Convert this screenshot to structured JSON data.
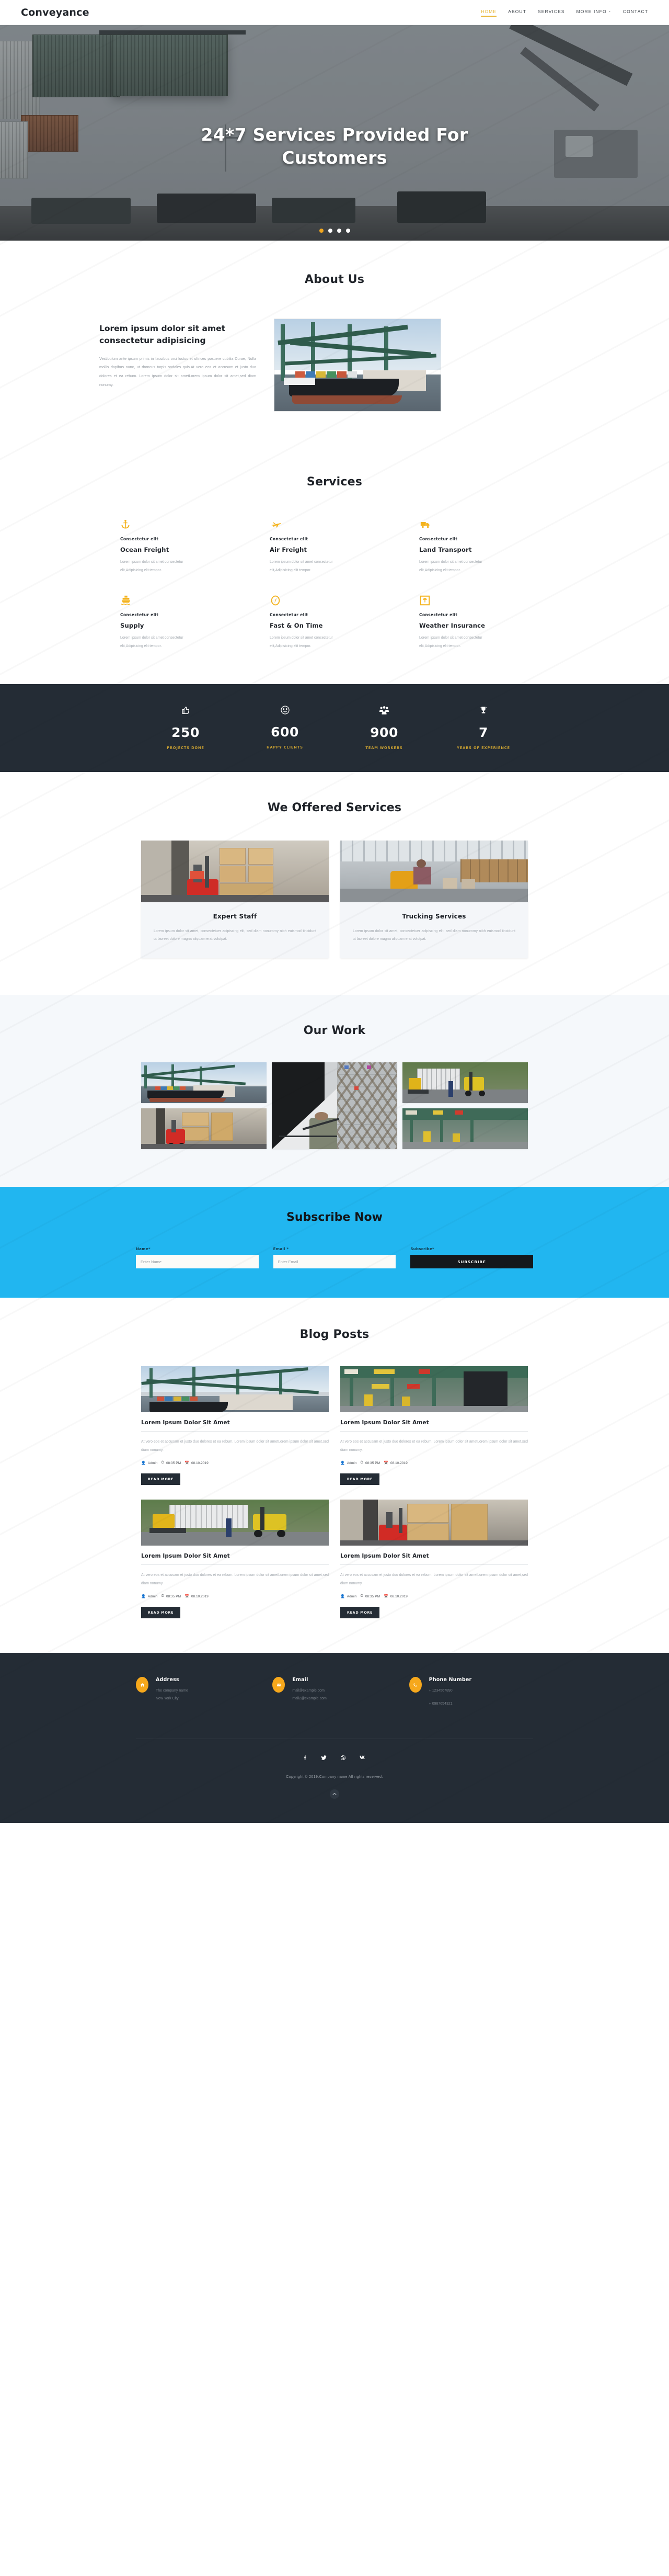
{
  "header": {
    "brand": "Conveyance",
    "nav": [
      {
        "label": "HOME",
        "active": true,
        "caret": ""
      },
      {
        "label": "ABOUT",
        "active": false,
        "caret": ""
      },
      {
        "label": "SERVICES",
        "active": false,
        "caret": ""
      },
      {
        "label": "MORE INFO",
        "active": false,
        "caret": "⌄"
      },
      {
        "label": "CONTACT",
        "active": false,
        "caret": ""
      }
    ]
  },
  "hero": {
    "title": "24*7 Services Provided For Customers",
    "slides": 4,
    "active_slide": 1
  },
  "about": {
    "section_title": "About Us",
    "heading": "Lorem ipsum dolor sit amet consectetur adipisicing",
    "text": "Vestibulum ante ipsum primis in faucibus orci luctus et ultrices posuere cubilia Curae; Nulla mollis dapibus nunc, ut rhoncus turpis sodales quis.At vero eos et accusam et justo duo dolores et ea rebum. Lorem ipsum dolor sit ametLorem ipsum dolor sit amet,sed diam nonumy."
  },
  "services": {
    "section_title": "Services",
    "items": [
      {
        "icon": "anchor-icon",
        "glyph": "⚓",
        "kicker": "Consectetur elit",
        "name": "Ocean Freight",
        "text": "Lorem ipsum dolor sit amet consectetur elit,Adipisicing elit tempor."
      },
      {
        "icon": "airplane-icon",
        "glyph": "✈",
        "kicker": "Consectetur elit",
        "name": "Air Freight",
        "text": "Lorem ipsum dolor sit amet consectetur elit,Adipisicing elit tempor."
      },
      {
        "icon": "truck-icon",
        "glyph": "🚚",
        "kicker": "Consectetur elit",
        "name": "Land Transport",
        "text": "Lorem ipsum dolor sit amet consectetur elit,Adipisicing elit tempor."
      },
      {
        "icon": "ship-icon",
        "glyph": "🚢",
        "kicker": "Consectetur elit",
        "name": "Supply",
        "text": "Lorem ipsum dolor sit amet consectetur elit,Adipisicing elit tempor."
      },
      {
        "icon": "compass-icon",
        "glyph": "◎",
        "kicker": "Consectetur elit",
        "name": "Fast & On Time",
        "text": "Lorem ipsum dolor sit amet consectetur elit,Adipisicing elit tempor."
      },
      {
        "icon": "umbrella-box-icon",
        "glyph": "▣",
        "kicker": "Consectetur elit",
        "name": "Weather Insurance",
        "text": "Lorem ipsum dolor sit amet consectetur elit,Adipisicing elit tempor."
      }
    ]
  },
  "stats": {
    "items": [
      {
        "icon": "thumbs-up-icon",
        "glyph": "👍",
        "number": "250",
        "label": "PROJECTS DONE"
      },
      {
        "icon": "smiley-icon",
        "glyph": "☺",
        "number": "600",
        "label": "HAPPY CLIENTS"
      },
      {
        "icon": "team-icon",
        "glyph": "👥",
        "number": "900",
        "label": "TEAM WORKERS"
      },
      {
        "icon": "trophy-icon",
        "glyph": "🏆",
        "number": "7",
        "label": "YEARS OF EXPERIENCE"
      }
    ]
  },
  "offered": {
    "section_title": "We Offered Services",
    "cards": [
      {
        "title": "Expert Staff",
        "text": "Lorem ipsum dolor sit amet, consectetuer adipiscing elit, sed diam nonummy nibh euismod tincidunt ut laoreet dolore magna aliquam erat volutpat."
      },
      {
        "title": "Trucking Services",
        "text": "Lorem ipsum dolor sit amet, consectetuer adipiscing elit, sed diam nonummy nibh euismod tincidunt ut laoreet dolore magna aliquam erat volutpat."
      }
    ]
  },
  "work": {
    "section_title": "Our Work",
    "items": [
      {
        "alt": "container-ship-at-port"
      },
      {
        "alt": "worker-on-platform"
      },
      {
        "alt": "forklift-loading-truck"
      },
      {
        "alt": "red-forklift-in-warehouse"
      },
      {
        "alt": "port-gantry-cranes"
      },
      {
        "alt": "stacked-shipping-containers"
      }
    ]
  },
  "subscribe": {
    "title": "Subscribe Now",
    "name_label": "Name*",
    "name_placeholder": "Enter Name",
    "email_label": "Email *",
    "email_placeholder": "Enter Email",
    "subscribe_label": "Subscribe*",
    "button": "SUBSCRIBE",
    "accent_color": "#21b6f0"
  },
  "blog": {
    "section_title": "Blog Posts",
    "posts": [
      {
        "title": "Lorem Ipsum Dolor Sit Amet",
        "text": "At vero eos et accusam et justo duo dolores et ea rebum. Lorem ipsum dolor sit ametLorem ipsum dolor sit amet,sed diam nonumy.",
        "author": "Admin",
        "time": "08:35 PM",
        "date": "08.10.2019",
        "button": "READ MORE",
        "alt": "port-cranes"
      },
      {
        "title": "Lorem Ipsum Dolor Sit Amet",
        "text": "At vero eos et accusam et justo duo dolores et ea rebum. Lorem ipsum dolor sit ametLorem ipsum dolor sit amet,sed diam nonumy.",
        "author": "Admin",
        "time": "08:35 PM",
        "date": "08.10.2019",
        "button": "READ MORE",
        "alt": "container-terminal-gantry"
      },
      {
        "title": "Lorem Ipsum Dolor Sit Amet",
        "text": "At vero eos et accusam et justo duo dolores et ea rebum. Lorem ipsum dolor sit ametLorem ipsum dolor sit amet,sed diam nonumy.",
        "author": "Admin",
        "time": "08:35 PM",
        "date": "08.10.2019",
        "button": "READ MORE",
        "alt": "forklift-loading-truck-outdoors"
      },
      {
        "title": "Lorem Ipsum Dolor Sit Amet",
        "text": "At vero eos et accusam et justo duo dolores et ea rebum. Lorem ipsum dolor sit ametLorem ipsum dolor sit amet,sed diam nonumy.",
        "author": "Admin",
        "time": "08:35 PM",
        "date": "08.10.2019",
        "button": "READ MORE",
        "alt": "red-forklift-warehouse-dock"
      }
    ]
  },
  "footer": {
    "columns": [
      {
        "icon": "home-icon",
        "glyph": "⌂",
        "heading": "Address",
        "lines": [
          "The company name",
          "New York City"
        ]
      },
      {
        "icon": "envelope-icon",
        "glyph": "✉",
        "heading": "Email",
        "lines": [
          "mail@example.com",
          "mail2@example.com"
        ]
      },
      {
        "icon": "phone-icon",
        "glyph": "✆",
        "heading": "Phone Number",
        "lines": [
          "+ 1234567890",
          "+ 0987654321"
        ]
      }
    ],
    "socials": [
      {
        "icon": "facebook-icon",
        "glyph": "f"
      },
      {
        "icon": "twitter-icon",
        "glyph": "🐦"
      },
      {
        "icon": "dribbble-icon",
        "glyph": "◉"
      },
      {
        "icon": "vk-icon",
        "glyph": "вĸ"
      }
    ],
    "copyright": "Copyright © 2019.Company name All rights reserved.",
    "to_top_icon": "chevron-up-icon",
    "to_top_glyph": "⌃"
  }
}
